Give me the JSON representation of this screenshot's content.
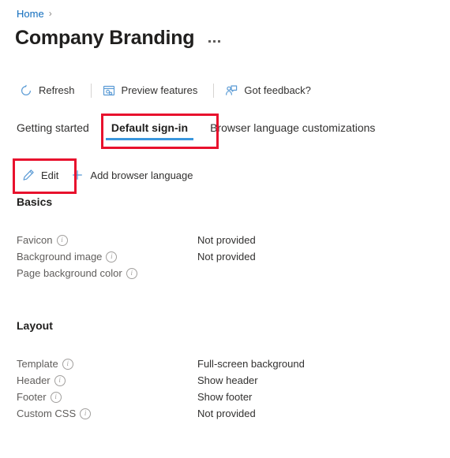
{
  "breadcrumb": {
    "items": [
      {
        "label": "Home",
        "icon": "none"
      }
    ],
    "separator": "›"
  },
  "header": {
    "title": "Company Branding",
    "more_icon": "ellipsis-icon"
  },
  "commandbar": {
    "items": [
      {
        "label": "Refresh",
        "icon": "refresh-icon"
      },
      {
        "label": "Preview features",
        "icon": "preview-features-icon"
      },
      {
        "label": "Got feedback?",
        "icon": "feedback-icon"
      }
    ]
  },
  "tabs": [
    {
      "label": "Getting started",
      "selected": false
    },
    {
      "label": "Default sign-in",
      "selected": true
    },
    {
      "label": "Browser language customizations",
      "selected": false
    }
  ],
  "actionbar": {
    "items": [
      {
        "label": "Edit",
        "icon": "pencil-icon"
      },
      {
        "label": "Add browser language",
        "icon": "plus-icon"
      }
    ]
  },
  "sections": [
    {
      "heading": "Basics",
      "rows": [
        {
          "label": "Favicon",
          "info": "info-icon",
          "value": "Not provided"
        },
        {
          "label": "Background image",
          "info": "info-icon",
          "value": "Not provided"
        },
        {
          "label": "Page background color",
          "info": "info-icon",
          "value": ""
        }
      ]
    },
    {
      "heading": "Layout",
      "rows": [
        {
          "label": "Template",
          "info": "info-icon",
          "value": "Full-screen background"
        },
        {
          "label": "Header",
          "info": "info-icon",
          "value": "Show header"
        },
        {
          "label": "Footer",
          "info": "info-icon",
          "value": "Show footer"
        },
        {
          "label": "Custom CSS",
          "info": "info-icon",
          "value": "Not provided"
        }
      ]
    }
  ],
  "annotations": {
    "highlight_color": "#e8112d",
    "boxes": [
      {
        "name": "default-sign-in-tab-highlight"
      },
      {
        "name": "edit-button-highlight"
      }
    ]
  },
  "colors": {
    "link": "#0f6cbd",
    "accent": "#3a96dd",
    "icon_blue": "#5b9bd5",
    "text": "#323130",
    "muted": "#605e5c"
  }
}
